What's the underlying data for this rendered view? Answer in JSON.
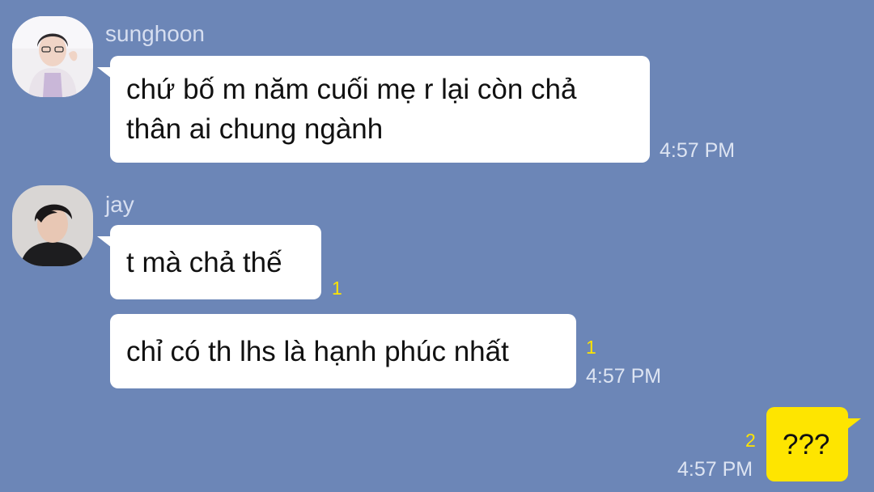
{
  "chat": {
    "colors": {
      "background": "#6c86b7",
      "incoming_bubble": "#ffffff",
      "outgoing_bubble": "#fee500",
      "unread_count": "#fde400"
    },
    "messages": [
      {
        "sender": "sunghoon",
        "avatar_icon": "profile-photo-icon",
        "lines": [
          "chứ bố m năm cuối mẹ r lại còn chả",
          "thân ai chung ngành"
        ],
        "time": "4:57 PM"
      },
      {
        "sender": "jay",
        "avatar_icon": "profile-photo-icon",
        "text": "t mà chả thế",
        "unread": "1"
      },
      {
        "text": "chỉ có th lhs là hạnh phúc nhất",
        "unread": "1",
        "time": "4:57 PM"
      },
      {
        "mine": true,
        "text": "???",
        "unread": "2",
        "time": "4:57 PM"
      }
    ]
  }
}
